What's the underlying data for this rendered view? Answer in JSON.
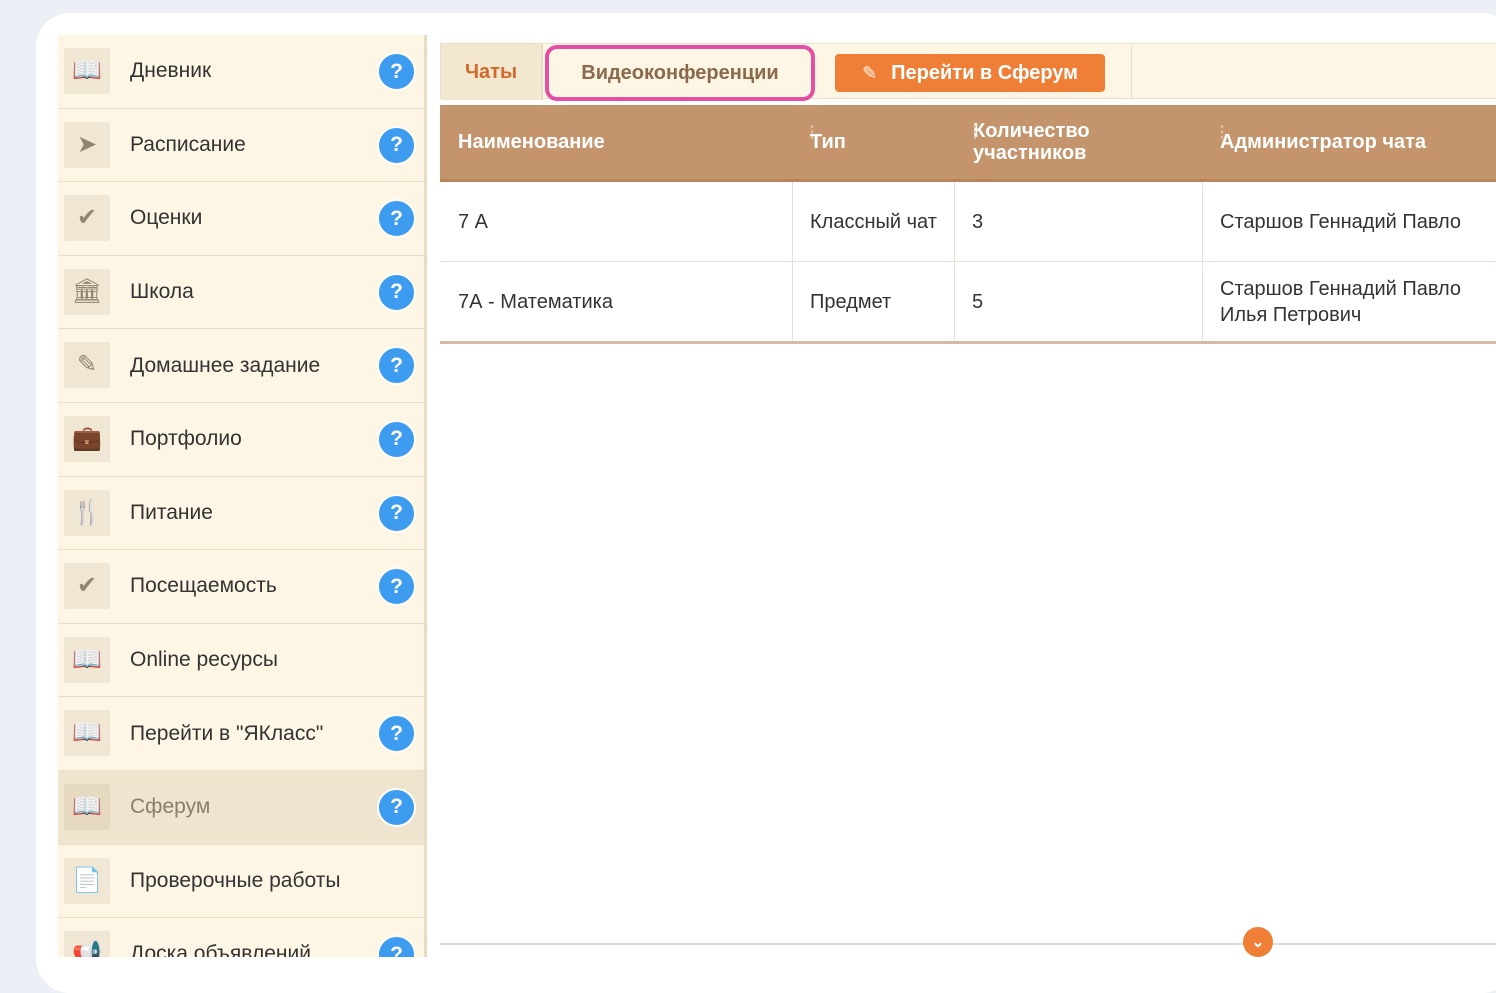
{
  "sidebar": {
    "items": [
      {
        "label": "Дневник",
        "icon": "book-icon",
        "glyph": "📖",
        "help": "?"
      },
      {
        "label": "Расписание",
        "icon": "paper-plane-icon",
        "glyph": "➤",
        "help": "?"
      },
      {
        "label": "Оценки",
        "icon": "checkmark-icon",
        "glyph": "✔",
        "help": "?"
      },
      {
        "label": "Школа",
        "icon": "school-building-icon",
        "glyph": "🏛",
        "help": "?"
      },
      {
        "label": "Домашнее задание",
        "icon": "board-icon",
        "glyph": "✎",
        "help": "?"
      },
      {
        "label": "Портфолио",
        "icon": "briefcase-icon",
        "glyph": "💼",
        "help": "?"
      },
      {
        "label": "Питание",
        "icon": "fork-knife-icon",
        "glyph": "🍴",
        "help": "?"
      },
      {
        "label": "Посещаемость",
        "icon": "checkmark-icon",
        "glyph": "✔",
        "help": "?"
      },
      {
        "label": "Online ресурсы",
        "icon": "book-icon",
        "glyph": "📖",
        "help": ""
      },
      {
        "label": "Перейти в \"ЯКласс\"",
        "icon": "book-icon",
        "glyph": "📖",
        "help": "?"
      },
      {
        "label": "Сферум",
        "icon": "book-icon",
        "glyph": "📖",
        "help": "?",
        "active": true
      },
      {
        "label": "Проверочные работы",
        "icon": "document-icon",
        "glyph": "📄",
        "help": ""
      },
      {
        "label": "Доска объявлений",
        "icon": "megaphone-icon",
        "glyph": "📢",
        "help": "?"
      }
    ]
  },
  "tabs": {
    "chats": "Чаты",
    "video": "Видеоконференции",
    "sferum_button": "Перейти в Сферум"
  },
  "table": {
    "columns": [
      "Наименование",
      "Тип",
      "Количество участников",
      "Администратор чата"
    ],
    "rows": [
      [
        "7 А",
        "Классный чат",
        "3",
        "Старшов Геннадий Павло"
      ],
      [
        "7А - Математика",
        "Предмет",
        "5",
        "Старшов Геннадий Павло Илья Петрович"
      ]
    ]
  },
  "colors": {
    "accent_orange": "#ef7f36",
    "header_brown": "#c4956c",
    "highlight_pink": "#e44ea4",
    "help_blue": "#3d9bf0"
  }
}
